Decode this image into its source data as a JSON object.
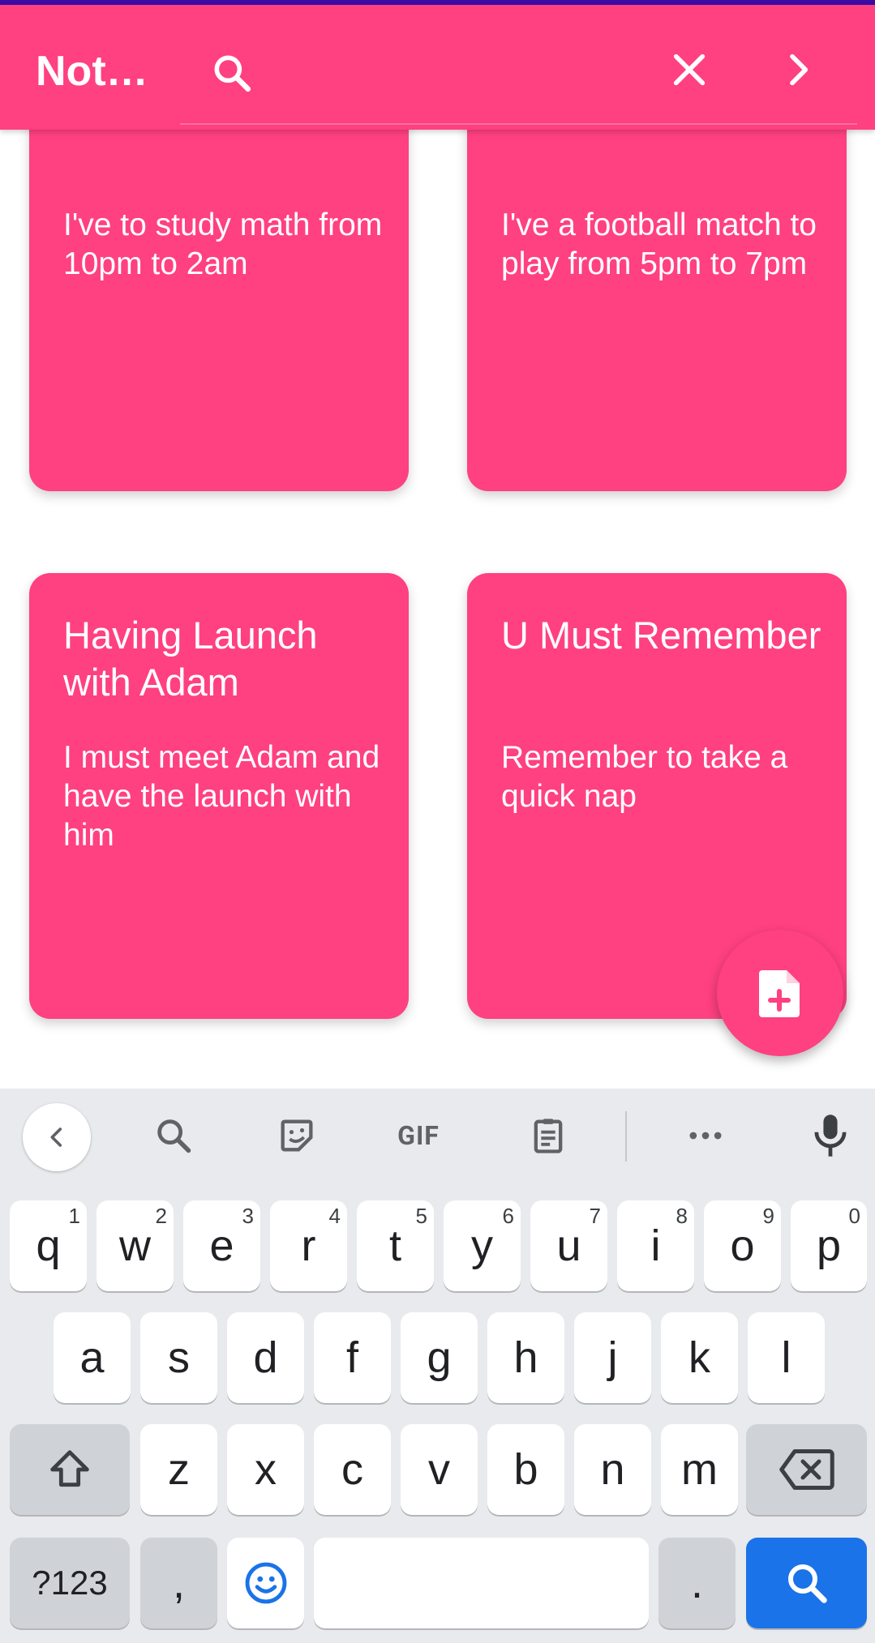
{
  "header": {
    "title": "Not…",
    "search_placeholder": ""
  },
  "notes": [
    {
      "title": "",
      "body": "I've to study math from 10pm to 2am"
    },
    {
      "title": "",
      "body": "I've a football match to play from 5pm to 7pm"
    },
    {
      "title": "Having Launch with Adam",
      "body": "I must meet Adam and have the launch with him"
    },
    {
      "title": "U Must Remember",
      "body": "Remember to take a quick nap"
    }
  ],
  "fab": {
    "icon": "add-note-icon"
  },
  "keyboard": {
    "toolbar": {
      "gif_label": "GIF"
    },
    "row1": [
      {
        "key": "q",
        "hint": "1"
      },
      {
        "key": "w",
        "hint": "2"
      },
      {
        "key": "e",
        "hint": "3"
      },
      {
        "key": "r",
        "hint": "4"
      },
      {
        "key": "t",
        "hint": "5"
      },
      {
        "key": "y",
        "hint": "6"
      },
      {
        "key": "u",
        "hint": "7"
      },
      {
        "key": "i",
        "hint": "8"
      },
      {
        "key": "o",
        "hint": "9"
      },
      {
        "key": "p",
        "hint": "0"
      }
    ],
    "row2": [
      "a",
      "s",
      "d",
      "f",
      "g",
      "h",
      "j",
      "k",
      "l"
    ],
    "row3": [
      "z",
      "x",
      "c",
      "v",
      "b",
      "n",
      "m"
    ],
    "row4": {
      "symbols": "?123",
      "comma": ",",
      "period": "."
    }
  },
  "colors": {
    "accent": "#ff4081",
    "keyboard_bg": "#e8eaed",
    "action_key": "#1a73e8"
  }
}
